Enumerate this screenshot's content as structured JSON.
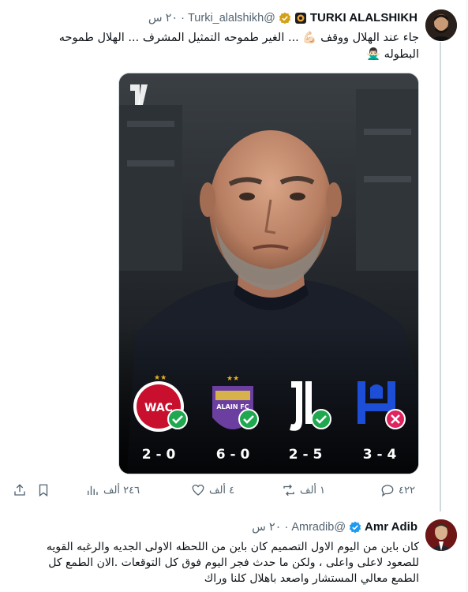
{
  "tweet1": {
    "display_name": "TURKI ALALSHIKH",
    "handle": "@Turki_alalshikh",
    "separator": "·",
    "time": "٢٠ س",
    "text": "جاء عند الهلال ووقف 💪🏻 ... الغير طموحه التمثيل المشرف ... الهلال طموحه البطوله 🙅🏻‍♂️",
    "media": {
      "results": [
        {
          "team": "Wydad AC",
          "score": "2 - 0",
          "outcome": "win"
        },
        {
          "team": "Al Ain FC",
          "score": "6 - 0",
          "outcome": "win"
        },
        {
          "team": "Juventus",
          "score": "2 - 5",
          "outcome": "win"
        },
        {
          "team": "Al Hilal",
          "score": "3 - 4",
          "outcome": "loss"
        }
      ],
      "alain_label": "ALAIN FC"
    },
    "actions": {
      "replies": "٤٢٢",
      "reposts": "١ ألف",
      "likes": "٤ ألف",
      "views": "٢٤٦ ألف"
    },
    "colors": {
      "win": "#1fa84f",
      "loss": "#e0245e",
      "hilal_blue": "#1d4ed8",
      "wydad_red": "#c8102e",
      "alain_purple": "#6b3fa0"
    }
  },
  "tweet2": {
    "display_name": "Amr Adib",
    "handle": "@Amradib",
    "separator": "·",
    "time": "٢٠ س",
    "text": "كان باين من اليوم الاول التصميم كان باين من اللحظه الاولى الجديه والرغبه القويه للصعود لاعلى واعلى ، ولكن ما حدث فجر اليوم فوق كل التوقعات .الان الطمع كل الطمع معالي المستشار واصعد باهلال كلنا وراك"
  },
  "icons": {
    "reply": "reply-icon",
    "repost": "repost-icon",
    "like": "heart-icon",
    "views": "views-icon",
    "bookmark": "bookmark-icon",
    "share": "share-icon",
    "verified": "verified-badge-icon"
  }
}
